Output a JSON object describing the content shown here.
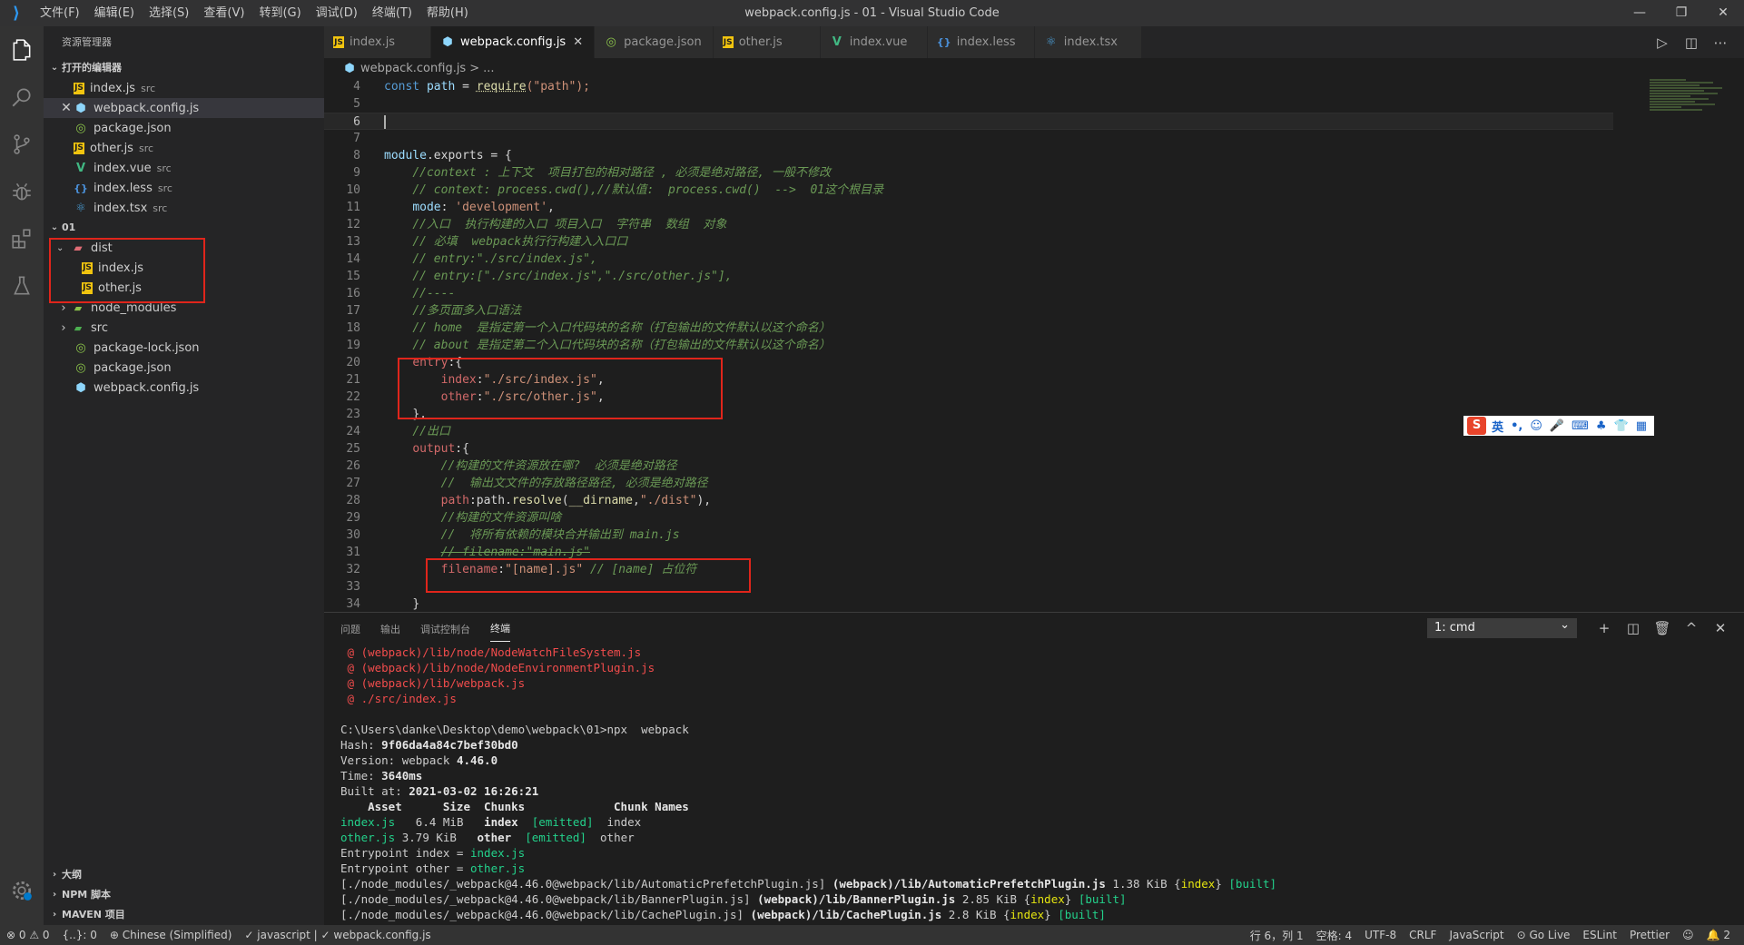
{
  "titlebar": {
    "menu": [
      "文件(F)",
      "编辑(E)",
      "选择(S)",
      "查看(V)",
      "转到(G)",
      "调试(D)",
      "终端(T)",
      "帮助(H)"
    ],
    "title": "webpack.config.js - 01 - Visual Studio Code",
    "controls": [
      "—",
      "❐",
      "✕"
    ]
  },
  "sidebar": {
    "title": "资源管理器",
    "open_editors_label": "打开的编辑器",
    "open_editors": [
      {
        "name": "index.js",
        "desc": "src",
        "icon": "js"
      },
      {
        "name": "webpack.config.js",
        "desc": "",
        "icon": "webpack"
      },
      {
        "name": "package.json",
        "desc": "",
        "icon": "json"
      },
      {
        "name": "other.js",
        "desc": "src",
        "icon": "js"
      },
      {
        "name": "index.vue",
        "desc": "src",
        "icon": "vue"
      },
      {
        "name": "index.less",
        "desc": "src",
        "icon": "less"
      },
      {
        "name": "index.tsx",
        "desc": "src",
        "icon": "tsx"
      }
    ],
    "folder_label": "01",
    "tree": {
      "dist": "dist",
      "dist_index": "index.js",
      "dist_other": "other.js",
      "node_modules": "node_modules",
      "src": "src",
      "package_lock": "package-lock.json",
      "package": "package.json",
      "webpack_config": "webpack.config.js"
    },
    "outline_label": "大纲",
    "npm_label": "NPM 脚本",
    "maven_label": "MAVEN 项目"
  },
  "tabs": [
    {
      "label": "index.js",
      "icon": "js"
    },
    {
      "label": "webpack.config.js",
      "icon": "webpack"
    },
    {
      "label": "package.json",
      "icon": "json"
    },
    {
      "label": "other.js",
      "icon": "js"
    },
    {
      "label": "index.vue",
      "icon": "vue"
    },
    {
      "label": "index.less",
      "icon": "less"
    },
    {
      "label": "index.tsx",
      "icon": "tsx"
    }
  ],
  "breadcrumb": {
    "file": "webpack.config.js",
    "sep": ">",
    "more": "..."
  },
  "code_lines": {
    "l4": "4",
    "l5": "5",
    "l6": "6",
    "l7": "7",
    "l8": "8",
    "l9": "9",
    "l10": "10",
    "l11": "11",
    "l12": "12",
    "l13": "13",
    "l14": "14",
    "l15": "15",
    "l16": "16",
    "l17": "17",
    "l18": "18",
    "l19": "19",
    "l20": "20",
    "l21": "21",
    "l22": "22",
    "l23": "23",
    "l24": "24",
    "l25": "25",
    "l26": "26",
    "l27": "27",
    "l28": "28",
    "l29": "29",
    "l30": "30",
    "l31": "31",
    "l32": "32",
    "l33": "33",
    "l34": "34"
  },
  "code": {
    "c4_const": "const",
    "c4_path": " path",
    "c4_eq": " = ",
    "c4_req": "require",
    "c4_arg": "(\"path\");",
    "c8_mod": "module",
    "c8_rest": ".exports = {",
    "c9": "//context : 上下文  项目打包的相对路径 , 必须是绝对路径, 一般不修改",
    "c10": "// context: process.cwd(),//默认值:  process.cwd()  -->  01这个根目录",
    "c11_key": "mode",
    "c11_val": "'development'",
    "c12": "//入口  执行构建的入口 项目入口  字符串  数组  对象",
    "c13": "// 必填  webpack执行行构建入入口口",
    "c14": "// entry:\"./src/index.js\",",
    "c15": "// entry:[\"./src/index.js\",\"./src/other.js\"],",
    "c16": "//----",
    "c17": "//多页面多入口语法",
    "c18": "// home  是指定第一个入口代码块的名称（打包输出的文件默认以这个命名）",
    "c19": "// about 是指定第二个入口代码块的名称（打包输出的文件默认以这个命名）",
    "c20_key": "entry",
    "c20_rest": ":{",
    "c21_key": "index",
    "c21_val": "\"./src/index.js\"",
    "c22_key": "other",
    "c22_val": "\"./src/other.js\"",
    "c23": "},",
    "c24": "//出口",
    "c25_key": "output",
    "c25_rest": ":{",
    "c26": "//构建的文件资源放在哪?  必须是绝对路径",
    "c27": "//  输出文文件的存放路径路径, 必须是绝对路径",
    "c28_key": "path",
    "c28_a": ":path.",
    "c28_fn": "resolve",
    "c28_b": "(",
    "c28_dn": "__dirname",
    "c28_c": ",",
    "c28_s": "\"./dist\"",
    "c28_d": "),",
    "c29": "//构建的文件资源叫啥",
    "c30": "//  将所有依赖的模块合并输出到 main.js",
    "c31": "// filename:\"main.js\"",
    "c32_key": "filename",
    "c32_val": "\"[name].js\"",
    "c32_cm": " // [name] 占位符",
    "c34": "}"
  },
  "ime": {
    "items": [
      "英",
      "•,",
      "☺",
      "🎤",
      "⌨",
      "♣",
      "👕",
      "▦"
    ]
  },
  "panel": {
    "tabs": [
      "问题",
      "输出",
      "调试控制台",
      "终端"
    ],
    "terminal_select": "1: cmd",
    "actions": [
      "+",
      "◫",
      "🗑",
      "^",
      "✕"
    ]
  },
  "terminal": {
    "e1": " @ (webpack)/lib/node/NodeWatchFileSystem.js",
    "e2": " @ (webpack)/lib/node/NodeEnvironmentPlugin.js",
    "e3": " @ (webpack)/lib/webpack.js",
    "e4": " @ ./src/index.js",
    "cmd": "C:\\Users\\danke\\Desktop\\demo\\webpack\\01>npx  webpack",
    "hash_label": "Hash: ",
    "hash": "9f06da4a84c7bef30bd0",
    "version_label": "Version: webpack ",
    "version": "4.46.0",
    "time_label": "Time: ",
    "time": "3640ms",
    "built_label": "Built at: ",
    "built": "2021-03-02 16:26:21",
    "header": "    Asset      Size  Chunks             Chunk Names",
    "r1_name": "index.js",
    "r1_size": "   6.4 MiB ",
    "r1_chunk": "  index ",
    "r1_emit": " [emitted]",
    "r1_cn": "  index",
    "r2_name": "other.js",
    "r2_size": " 3.79 KiB ",
    "r2_chunk": "  other ",
    "r2_emit": " [emitted]",
    "r2_cn": "  other",
    "ep1_label": "Entrypoint index = ",
    "ep1": "index.js",
    "ep2_label": "Entrypoint other = ",
    "ep2": "other.js",
    "m1_a": "[./node_modules/_webpack@4.46.0@webpack/lib/AutomaticPrefetchPlugin.js] ",
    "m1_b": "(webpack)/lib/AutomaticPrefetchPlugin.js",
    "m1_c": " 1.38 KiB {",
    "m1_d": "index",
    "m1_e": "} ",
    "m1_f": "[built]",
    "m2_a": "[./node_modules/_webpack@4.46.0@webpack/lib/BannerPlugin.js] ",
    "m2_b": "(webpack)/lib/BannerPlugin.js",
    "m2_c": " 2.85 KiB {",
    "m2_d": "index",
    "m2_e": "} ",
    "m2_f": "[built]",
    "m3_a": "[./node_modules/_webpack@4.46.0@webpack/lib/CachePlugin.js] ",
    "m3_b": "(webpack)/lib/CachePlugin.js",
    "m3_c": " 2.8 KiB {",
    "m3_d": "index",
    "m3_e": "} ",
    "m3_f": "[built]"
  },
  "statusbar": {
    "errors": "⊗ 0 ⚠ 0",
    "sel": "{..}: 0",
    "lang_pack": "⊕ Chinese (Simplified)",
    "js": "✓ javascript | ✓ webpack.config.js",
    "pos": "行 6，列 1",
    "spaces": "空格: 4",
    "enc": "UTF-8",
    "eol": "CRLF",
    "mode": "JavaScript",
    "golive": "⊙ Go Live",
    "eslint": "ESLint",
    "prettier": "Prettier",
    "feedback": "☺",
    "bell": "🔔 2"
  },
  "colors": {
    "accent": "#007acc",
    "annotation": "#e0251b",
    "background": "#1e1e1e"
  }
}
